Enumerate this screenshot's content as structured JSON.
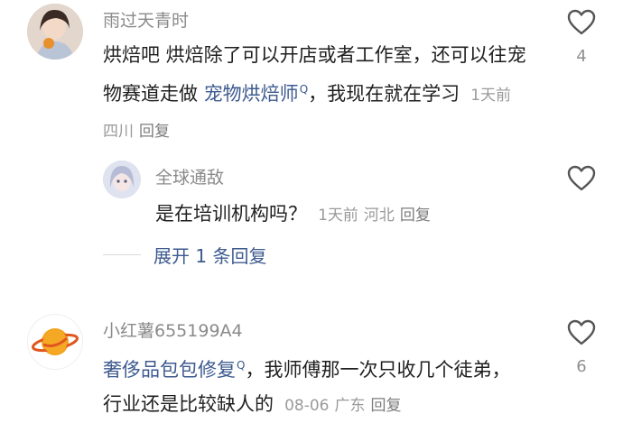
{
  "comments": [
    {
      "user": "雨过天青时",
      "text_parts": [
        "烘焙吧 烘焙除了可以开店或者工作室，还可以往",
        "宠物赛道走做 ",
        "宠物烘焙师",
        "，我现在就在学习"
      ],
      "link_sup": "Q",
      "time": "1天前",
      "location": "四川",
      "reply_label": "回复",
      "likes": "4",
      "like_icon": "heart-outline-icon"
    },
    {
      "user": "全球通敌",
      "text": "是在培训机构吗？",
      "time": "1天前",
      "location": "河北",
      "reply_label": "回复",
      "like_icon": "heart-outline-icon"
    },
    {
      "user": "小红薯655199A4",
      "link_text": "奢侈品包包修复",
      "link_sup": "Q",
      "text_after": "，我师傅那一次只收几个徒弟，行业还是比较缺人的",
      "time": "08-06",
      "location": "广东",
      "reply_label": "回复",
      "likes": "6",
      "like_icon": "heart-outline-icon"
    }
  ],
  "expand_replies": "展开 1 条回复",
  "colors": {
    "link": "#3d5a8f",
    "username": "#8a8a8a",
    "meta": "#9a9a9a",
    "text": "#1f1f1f"
  }
}
